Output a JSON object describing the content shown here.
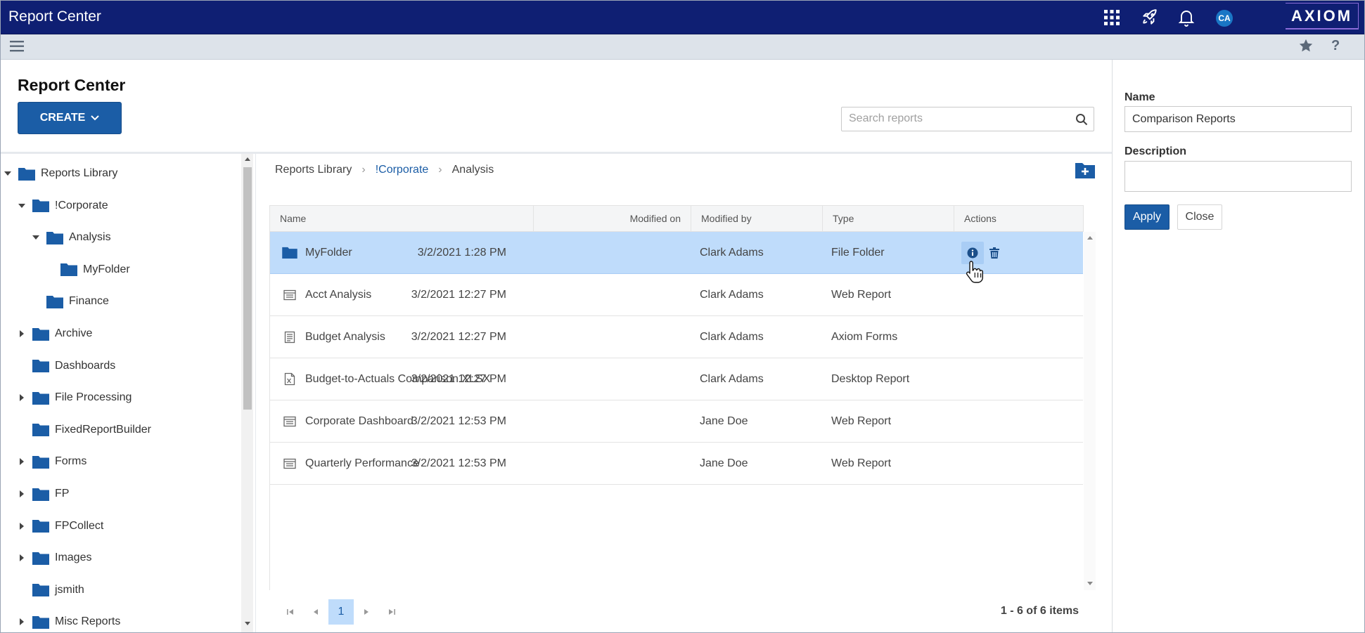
{
  "app": {
    "title": "Report Center",
    "avatar_initials": "CA",
    "logo": "AXIOM"
  },
  "topbar_icons": [
    "apps-grid-icon",
    "rocket-icon",
    "bell-icon"
  ],
  "subbar_icons": [
    "hamburger-menu-icon",
    "star-icon",
    "help-icon"
  ],
  "header": {
    "title": "Report Center",
    "create_label": "CREATE",
    "search_placeholder": "Search reports"
  },
  "tree": {
    "items": [
      {
        "label": "Reports Library",
        "caret": "down"
      },
      {
        "label": "!Corporate",
        "caret": "down"
      },
      {
        "label": "Analysis",
        "caret": "down"
      },
      {
        "label": "MyFolder",
        "caret": "none"
      },
      {
        "label": "Finance",
        "caret": "none"
      },
      {
        "label": "Archive",
        "caret": "right"
      },
      {
        "label": "Dashboards",
        "caret": "none"
      },
      {
        "label": "File Processing",
        "caret": "right"
      },
      {
        "label": "FixedReportBuilder",
        "caret": "none"
      },
      {
        "label": "Forms",
        "caret": "right"
      },
      {
        "label": "FP",
        "caret": "right"
      },
      {
        "label": "FPCollect",
        "caret": "right"
      },
      {
        "label": "Images",
        "caret": "right"
      },
      {
        "label": "jsmith",
        "caret": "none"
      },
      {
        "label": "Misc Reports",
        "caret": "right"
      }
    ]
  },
  "breadcrumb": {
    "items": [
      {
        "label": "Reports Library"
      },
      {
        "label": "!Corporate"
      },
      {
        "label": "Analysis"
      }
    ]
  },
  "grid": {
    "columns": [
      "Name",
      "Modified on",
      "Modified by",
      "Type",
      "Actions"
    ],
    "rows": [
      {
        "name": "MyFolder",
        "modified_on": "3/2/2021 1:28 PM",
        "modified_by": "Clark Adams",
        "type": "File Folder",
        "icon": "folder-icon",
        "selected": true
      },
      {
        "name": "Acct Analysis",
        "modified_on": "3/2/2021 12:27 PM",
        "modified_by": "Clark Adams",
        "type": "Web Report",
        "icon": "web-report-icon"
      },
      {
        "name": "Budget Analysis",
        "modified_on": "3/2/2021 12:27 PM",
        "modified_by": "Clark Adams",
        "type": "Axiom Forms",
        "icon": "form-icon"
      },
      {
        "name": "Budget-to-Actuals Comparison.XLSX",
        "modified_on": "3/2/2021 12:27 PM",
        "modified_by": "Clark Adams",
        "type": "Desktop Report",
        "icon": "excel-file-icon"
      },
      {
        "name": "Corporate Dashboard",
        "modified_on": "3/2/2021 12:53 PM",
        "modified_by": "Jane Doe",
        "type": "Web Report",
        "icon": "web-report-icon"
      },
      {
        "name": "Quarterly Performance",
        "modified_on": "3/2/2021 12:53 PM",
        "modified_by": "Jane Doe",
        "type": "Web Report",
        "icon": "web-report-icon"
      }
    ]
  },
  "pager": {
    "current_page": "1",
    "summary": "1 - 6 of 6 items"
  },
  "panel": {
    "name_label": "Name",
    "name_value": "Comparison Reports",
    "description_label": "Description",
    "description_value": "",
    "apply_label": "Apply",
    "close_label": "Close"
  },
  "colors": {
    "topbar": "#0f1f73",
    "primary": "#1b5da6",
    "selected_row": "#bfdcfb",
    "folder": "#1b5da6"
  }
}
